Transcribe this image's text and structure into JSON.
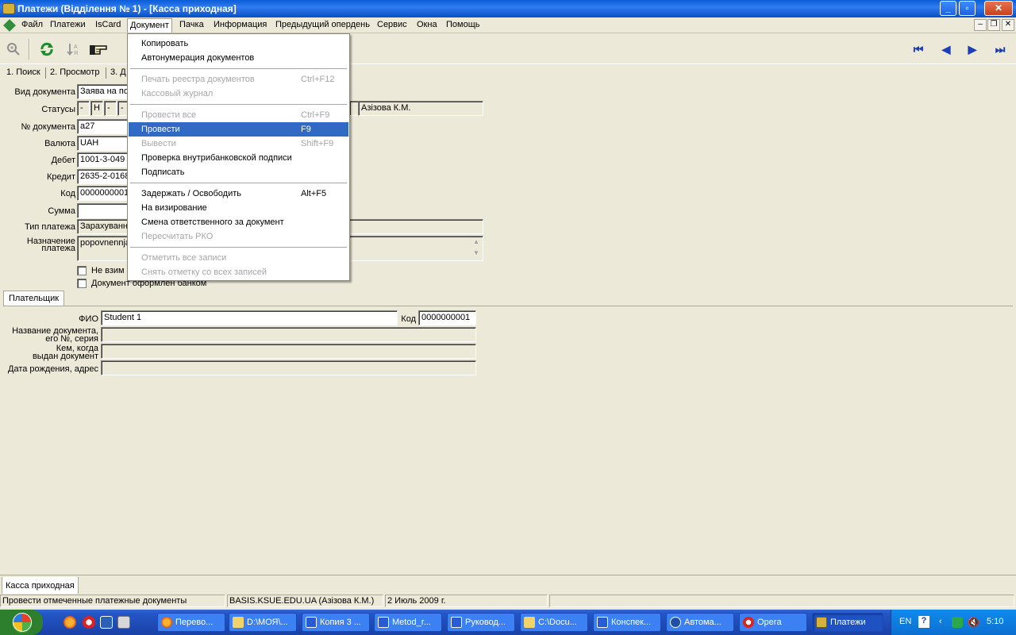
{
  "window": {
    "title": "Платежи (Відділення № 1) - [Касса приходная]",
    "buttons": {
      "minimize": "_",
      "maximize": "▫",
      "close": "✕"
    }
  },
  "menubar": {
    "items": [
      "Файл",
      "Платежи",
      "IsCard",
      "Документ",
      "Пачка",
      "Информация",
      "Предыдущий опердень",
      "Сервис",
      "Окна",
      "Помощь"
    ],
    "active_index": 3,
    "mdi": {
      "minimize": "–",
      "restore": "❐",
      "close": "✕"
    }
  },
  "toolbar": {
    "icons": [
      "zoom-icon",
      "refresh-icon",
      "sort-icon",
      "pointer-icon"
    ],
    "nav": {
      "first": "⏮",
      "prev": "◀",
      "next": "▶",
      "last": "⏭"
    }
  },
  "tabs": [
    "1. Поиск",
    "2. Просмотр",
    "3. Д"
  ],
  "form": {
    "vid_label": "Вид документа",
    "vid_value": "Заява на по",
    "status_label": "Статусы",
    "status_values": [
      "-",
      "Н",
      "-",
      "-"
    ],
    "status_user": "Азізова К.М.",
    "nom_label": "№ документа",
    "nom_value": "а27",
    "val_label": "Валюта",
    "val_value": "UAH",
    "debet_label": "Дебет",
    "debet_value": "1001-3-049",
    "kredit_label": "Кредит",
    "kredit_value": "2635-2-0168",
    "kod_label": "Код",
    "kod_value": "0000000001",
    "summa_label": "Сумма",
    "summa_value": "",
    "tip_label": "Тип платежа",
    "tip_value": "Зарахуванн",
    "nazn_label_1": "Назначение",
    "nazn_label_2": "платежа",
    "nazn_value": "popovnennja",
    "check1_label": "Не взим",
    "check2_label": "Документ оформлен банком"
  },
  "payer": {
    "tab_label": "Плательщик",
    "fio_label": "ФИО",
    "fio_value": "Student 1",
    "kod_label": "Код",
    "kod_value": "0000000001",
    "doc_label_1": "Название документа,",
    "doc_label_2": "его №, серия",
    "issued_label_1": "Кем, когда",
    "issued_label_2": "выдан документ",
    "dob_label": "Дата рождения, адрес"
  },
  "dropdown": {
    "items": [
      {
        "label": "Копировать",
        "key": "",
        "disabled": false
      },
      {
        "label": "Автонумерация документов",
        "key": "",
        "disabled": false
      },
      {
        "label": "Печать реестра документов",
        "key": "Ctrl+F12",
        "disabled": true
      },
      {
        "label": "Кассовый журнал",
        "key": "",
        "disabled": true
      },
      {
        "label": "Провести все",
        "key": "Ctrl+F9",
        "disabled": true
      },
      {
        "label": "Провести",
        "key": "F9",
        "disabled": false,
        "highlighted": true
      },
      {
        "label": "Вывести",
        "key": "Shift+F9",
        "disabled": true
      },
      {
        "label": "Проверка внутрибанковской подписи",
        "key": "",
        "disabled": false
      },
      {
        "label": "Подписать",
        "key": "",
        "disabled": false
      },
      {
        "label": "Задержать / Освободить",
        "key": "Alt+F5",
        "disabled": false
      },
      {
        "label": "На визирование",
        "key": "",
        "disabled": false
      },
      {
        "label": "Смена ответственного за документ",
        "key": "",
        "disabled": false
      },
      {
        "label": "Пересчитать РКО",
        "key": "",
        "disabled": true
      },
      {
        "label": "Отметить все записи",
        "key": "",
        "disabled": true
      },
      {
        "label": "Снять отметку со всех записей",
        "key": "",
        "disabled": true
      }
    ]
  },
  "bottom_tab": "Касса приходная",
  "statusbar": {
    "hint": "Провести отмеченные платежные документы",
    "user": "BASIS.KSUE.EDU.UA (Азізова К.М.)",
    "date": "2 Июль 2009 г."
  },
  "taskbar": {
    "tasks": [
      "Перево...",
      "D:\\МОЯ\\...",
      "Копия 3 ...",
      "Metod_r...",
      "Руковод...",
      "C:\\Docu...",
      "Конспек...",
      "Автома...",
      "Opera",
      "Платежи"
    ],
    "active_index": 9,
    "tray": {
      "lang": "EN",
      "help": "?",
      "time": "5:10"
    }
  },
  "colors": {
    "titlebar": "#0a5cd8",
    "highlight": "#316ac5",
    "taskbar": "#2456c7",
    "start": "#3a9d3a"
  }
}
